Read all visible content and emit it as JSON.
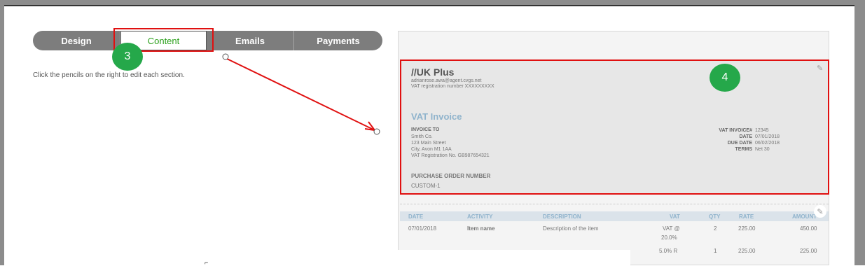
{
  "tabs": [
    {
      "label": "Design"
    },
    {
      "label": "Content"
    },
    {
      "label": "Emails"
    },
    {
      "label": "Payments"
    }
  ],
  "hint_text": "Click the pencils on the right to edit each section.",
  "annotations": {
    "step3": "3",
    "step4": "4"
  },
  "colors": {
    "accent_green": "#2ca01c",
    "badge_green": "#25a84a",
    "highlight_red": "#e01010",
    "invoice_blue": "#8fb3cc"
  },
  "invoice": {
    "company": "//UK Plus",
    "email": "adrianrose.awa@agent.cvgs.net",
    "vat_registration": "VAT registration number XXXXXXXXX",
    "title": "VAT Invoice",
    "invoice_to_label": "INVOICE TO",
    "invoice_to_lines": [
      "Smith Co.",
      "123 Main Street",
      "City, Avon M1 1AA",
      "VAT Registration No.  GB987654321"
    ],
    "meta": [
      {
        "label": "VAT INVOICE#",
        "value": "12345"
      },
      {
        "label": "DATE",
        "value": "07/01/2018"
      },
      {
        "label": "DUE DATE",
        "value": "06/02/2018"
      },
      {
        "label": "TERMS",
        "value": "Net 30"
      }
    ],
    "po_label": "PURCHASE ORDER NUMBER",
    "po_value": "CUSTOM-1",
    "table_headers": [
      "DATE",
      "ACTIVITY",
      "DESCRIPTION",
      "VAT",
      "QTY",
      "RATE",
      "AMOUNT"
    ],
    "row1": {
      "date": "07/01/2018",
      "activity": "Item name",
      "description": "Description of the item",
      "vat": "VAT @",
      "vat2": "20.0%",
      "qty": "2",
      "rate": "225.00",
      "amount": "450.00"
    },
    "row2": {
      "vat": "5.0% R",
      "qty": "1",
      "rate": "225.00",
      "amount": "225.00"
    }
  },
  "icons": {
    "edit": "pencil-icon"
  }
}
